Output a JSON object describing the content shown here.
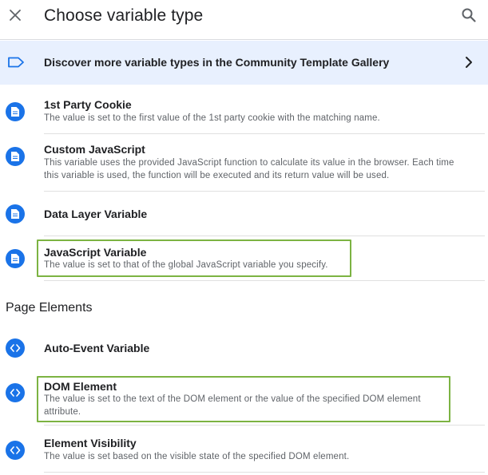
{
  "header": {
    "title": "Choose variable type"
  },
  "banner": {
    "text": "Discover more variable types in the Community Template Gallery"
  },
  "items": [
    {
      "name": "1st Party Cookie",
      "desc": "The value is set to the first value of the 1st party cookie with the matching name."
    },
    {
      "name": "Custom JavaScript",
      "desc": "This variable uses the provided JavaScript function to calculate its value in the browser. Each time this variable is used, the function will be executed and its return value will be used."
    },
    {
      "name": "Data Layer Variable",
      "desc": ""
    },
    {
      "name": "JavaScript Variable",
      "desc": "The value is set to that of the global JavaScript variable you specify."
    }
  ],
  "section": {
    "title": "Page Elements"
  },
  "page_elements": [
    {
      "name": "Auto-Event Variable",
      "desc": ""
    },
    {
      "name": "DOM Element",
      "desc": "The value is set to the text of the DOM element or the value of the specified DOM element attribute."
    },
    {
      "name": "Element Visibility",
      "desc": "The value is set based on the visible state of the specified DOM element."
    }
  ],
  "colors": {
    "accent": "#1a73e8",
    "banner_bg": "#e8f0fe",
    "highlight": "#7cb342"
  },
  "icons": {
    "close": "close-icon",
    "search": "search-icon",
    "banner": "label-tag-icon",
    "chevron": "chevron-right-icon",
    "variable": "document-icon",
    "page_element": "code-brackets-icon"
  }
}
